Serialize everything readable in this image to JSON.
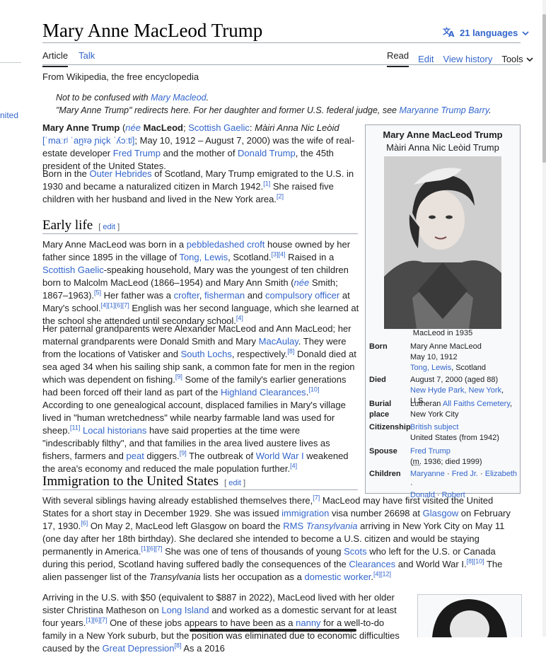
{
  "title": "Mary Anne MacLeod Trump",
  "languages": "21 languages",
  "tabs": {
    "article": "Article",
    "talk": "Talk",
    "read": "Read",
    "edit": "Edit",
    "history": "View history",
    "tools": "Tools"
  },
  "left_edge_text": "nited",
  "from": "From Wikipedia, the free encyclopedia",
  "hat1": {
    "pre": "Not to be confused with ",
    "link": "Mary Macleod",
    "post": "."
  },
  "hat2": {
    "pre": "\"Mary Anne Trump\" redirects here. For her daughter and former U.S. federal judge, see ",
    "link": "Maryanne Trump Barry",
    "post": "."
  },
  "lead1": {
    "a": "Mary Anne Trump",
    "b": " (",
    "nee": "née",
    "c": " ",
    "d": "MacLeod",
    "e": "; ",
    "gaelic": "Scottish Gaelic",
    "f": ": ",
    "g": "Màiri Anna Nic Leòid",
    "h": " ",
    "ipa": "[ˈmaːrʲ ˈan̪ˠə ɲiçk ˈʎɔːtʲ]",
    "i": "; May 10, 1912 – August 7, 2000) was the wife of real-estate developer ",
    "fred": "Fred Trump",
    "j": " and the mother of ",
    "donald": "Donald Trump",
    "k": ", the 45th president of the United States."
  },
  "lead2": {
    "a": "Born in the ",
    "hebrides": "Outer Hebrides",
    "b": " of Scotland, Mary Trump emigrated to the U.S. in 1930 and became a naturalized citizen in March 1942.",
    "r1": "[1]",
    "c": " She raised five children with her husband and lived in the New York area.",
    "r2": "[2]"
  },
  "early": {
    "heading": "Early life",
    "edit": "edit",
    "p1": {
      "a": "Mary Anne MacLeod was born in a ",
      "croft": "pebbledashed croft",
      "b": " house owned by her father since 1895 in the village of ",
      "tong": "Tong, Lewis",
      "c": ", Scotland.",
      "r1": "[3][4]",
      "d": " Raised in a ",
      "gaelic": "Scottish Gaelic",
      "e": "-speaking household, Mary was the youngest of ten children born to Malcolm MacLeod (1866–1954) and Mary Ann Smith (",
      "nee": "née",
      "f": " Smith; 1867–1963).",
      "r2": "[5]",
      "g": " Her father was a ",
      "crofter": "crofter",
      "h": ", ",
      "fisherman": "fisherman",
      "i": " and ",
      "officer": "compulsory officer",
      "j": " at Mary's school.",
      "r3": "[4][1][6][7]",
      "k": " English was her second language, which she learned at the school she attended until secondary school.",
      "r4": "[4]"
    },
    "p2": {
      "a": "Her paternal grandparents were Alexander MacLeod and Ann MacLeod; her maternal grandparents were Donald Smith and Mary ",
      "macaulay": "MacAulay",
      "b": ". They were from the locations of Vatisker and ",
      "lochs": "South Lochs",
      "c": ", respectively.",
      "r1": "[8]",
      "d": " Donald died at sea aged 34 when his sailing ship sank, a common fate for men in the region which was dependent on fishing.",
      "r2": "[9]",
      "e": " Some of the family's earlier generations had been forced off their land as part of the ",
      "clear": "Highland Clearances",
      "f": ".",
      "r3": "[10]",
      "g": " According to one genealogical account, displaced families in Mary's village lived in \"human wretchedness\" while nearby farmable land was used for sheep.",
      "r4": "[11]",
      "h": " ",
      "hist": "Local historians",
      "i": " have said properties at the time were \"indescribably filthy\", and that families in the area lived austere lives as fishers, farmers and ",
      "peat": "peat",
      "j": " diggers.",
      "r5": "[9]",
      "k": " The outbreak of ",
      "ww1": "World War I",
      "l": " weakened the area's economy and reduced the male population further.",
      "r6": "[4]"
    }
  },
  "immig": {
    "heading": "Immigration to the United States",
    "edit": "edit",
    "p1": {
      "a": "With several siblings having already established themselves there,",
      "r1": "[7]",
      "b": " MacLeod may have first visited the United States for a short stay in December 1929. She was issued ",
      "imm": "immigration",
      "c": " visa number 26698 at ",
      "glasgow": "Glasgow",
      "d": " on February 17, 1930.",
      "r2": "[6]",
      "e": " On May 2, MacLeod left Glasgow on board the ",
      "rms": "RMS ",
      "transyl": "Transylvania",
      "f": " arriving in New York City on May 11 (one day after her 18th birthday). She declared she intended to become a U.S. citizen and would be staying permanently in America.",
      "r3": "[1][6][7]",
      "g": " She was one of tens of thousands of young ",
      "scots": "Scots",
      "h": " who left for the U.S. or Canada during this period, Scotland having suffered badly the consequences of the ",
      "clearances": "Clearances",
      "i": " and World War I.",
      "r4": "[8][10]",
      "j": " The alien passenger list of the ",
      "transyl2": "Transylvania",
      "k": " lists her occupation as a ",
      "worker": "domestic worker",
      "l": ".",
      "r5": "[4][12]"
    },
    "p2": {
      "a": "Arriving in the U.S. with $50 (equivalent to $887 in 2022), MacLeod lived with her older sister Christina Matheson on ",
      "li": "Long Island",
      "b": " and worked as a domestic servant for at least four years.",
      "r1": "[1][6][7]",
      "c": " One of these jobs appears to have been as a ",
      "nanny": "nanny",
      "d": " for a well-to-do family in a New York suburb, but the position was eliminated due to economic difficulties caused by the ",
      "gd": "Great Depression",
      "r2": "[8]",
      "e": " As a 2016"
    }
  },
  "infobox": {
    "title": "Mary Anne MacLeod Trump",
    "subtitle": "Màiri Anna Nic Leòid Trump",
    "caption": "MacLeod in 1935",
    "born_label": "Born",
    "born_1": "Mary Anne MacLeod",
    "born_2": "May 10, 1912",
    "born_link": "Tong, Lewis",
    "born_3": ", Scotland",
    "died_label": "Died",
    "died_1": "August 7, 2000 (aged 88)",
    "died_link": "New Hyde Park, New York",
    "died_2": ", U.S.",
    "burial_label": "Burial place",
    "burial_1": "Lutheran ",
    "burial_link": "All Faiths Cemetery",
    "burial_2": ",",
    "burial_3": "New York City",
    "cit_label": "Citizenship",
    "cit_link": "British subject",
    "cit_2": "United States (from 1942)",
    "spouse_label": "Spouse",
    "spouse_link": "Fred Trump",
    "spouse_m": "m.",
    "spouse_2": " 1936; died 1999)",
    "children_label": "Children",
    "children": [
      "Maryanne",
      "Fred Jr.",
      "Elizabeth",
      "Donald",
      "Robert"
    ]
  }
}
